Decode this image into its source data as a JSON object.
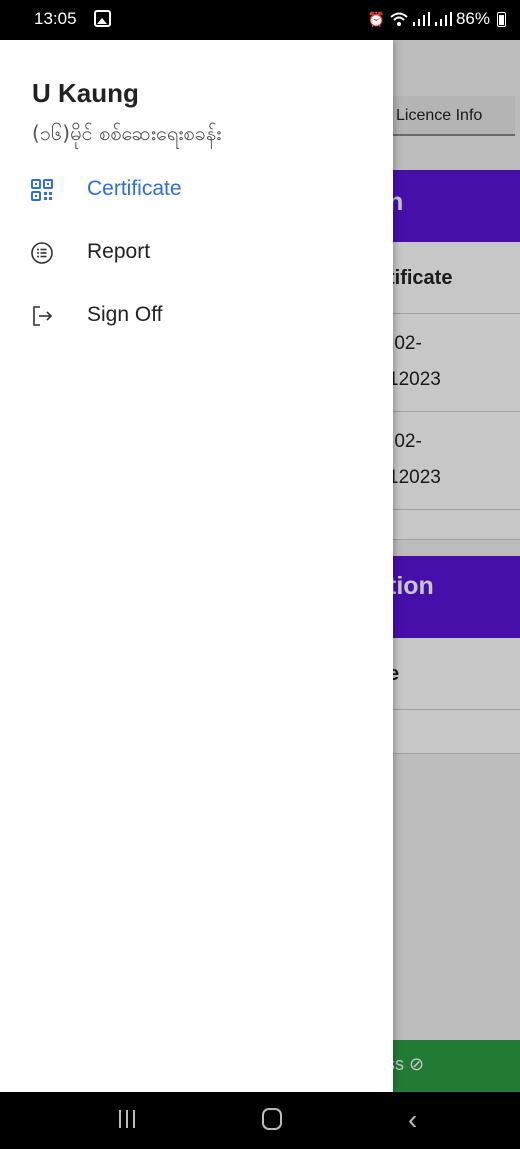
{
  "status_bar": {
    "time": "13:05",
    "battery": "86%",
    "icons": [
      "gallery-icon",
      "alarm-icon",
      "wifi-icon",
      "signal-icon",
      "signal-icon",
      "battery-icon"
    ]
  },
  "background": {
    "tab_label": "Licence Info",
    "section1_header": "n",
    "section1_rows": [
      "tificate",
      ")02-",
      "12023",
      ")02-",
      "12023"
    ],
    "section2_header": "tion",
    "section2_rows": [
      "e"
    ],
    "success_label": "ss",
    "colors": {
      "header": "#5a14d9",
      "success": "#2b9e44"
    }
  },
  "drawer": {
    "user_name": "U Kaung",
    "user_subtitle": "(၁၆)မိုင် စစ်ဆေးရေးစခန်း",
    "menu": [
      {
        "label": "Certificate",
        "icon": "qr-code-icon",
        "active": true
      },
      {
        "label": "Report",
        "icon": "list-icon",
        "active": false
      },
      {
        "label": "Sign Off",
        "icon": "sign-off-icon",
        "active": false
      }
    ],
    "colors": {
      "active": "#2f6fd6",
      "text": "#222222"
    }
  }
}
